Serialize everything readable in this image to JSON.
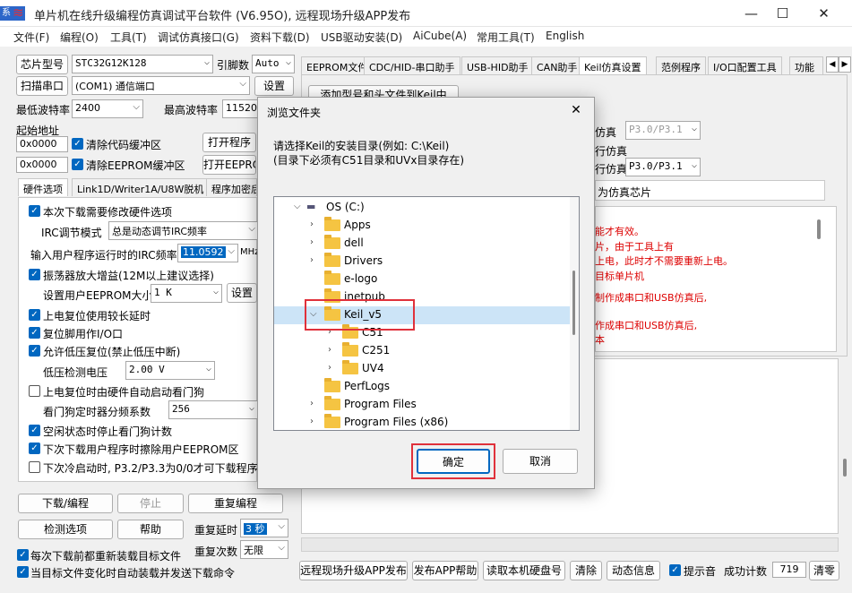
{
  "window": {
    "title": "单片机在线升级编程仿真调试平台软件 (V6.95O), 远程现场升级APP发布",
    "icon_text": "系",
    "minimize": "—",
    "maximize": "☐",
    "close": "✕"
  },
  "menu": [
    "文件(F)",
    "编程(O)",
    "工具(T)",
    "调试仿真接口(G)",
    "资料下载(D)",
    "USB驱动安装(D)",
    "AiCube(A)",
    "常用工具(T)",
    "English"
  ],
  "left": {
    "chip_type_btn": "芯片型号",
    "chip_type": "STC32G12K128",
    "pin_label": "引脚数",
    "pin_value": "Auto",
    "scan_port_btn": "扫描串口",
    "port_value": "(COM1) 通信端口",
    "settings_btn": "设置",
    "min_baud_label": "最低波特率",
    "min_baud": "2400",
    "max_baud_label": "最高波特率",
    "max_baud": "115200",
    "start_addr_label": "起始地址",
    "addr1": "0x0000",
    "clear_code_label": "清除代码缓冲区",
    "open_prog_btn": "打开程序",
    "addr2": "0x0000",
    "clear_eeprom_label": "清除EEPROM缓冲区",
    "open_eeprom_btn": "打开EEPRO",
    "tabs": [
      "硬件选项",
      "Link1D/Writer1A/U8W脱机",
      "程序加密后"
    ],
    "options": {
      "opt1": "本次下载需要修改硬件选项",
      "irc_mode_label": "IRC调节模式",
      "irc_mode": "总是动态调节IRC频率",
      "irc_freq_label": "输入用户程序运行时的IRC频率",
      "irc_freq": "11.0592",
      "irc_unit": "MHz",
      "opt_osc": "振荡器放大增益(12M以上建议选择)",
      "eeprom_label": "设置用户EEPROM大小",
      "eeprom_value": "1    K",
      "eeprom_btn": "设置",
      "opt_delay": "上电复位使用较长延时",
      "opt_reset": "复位脚用作I/O口",
      "opt_lowv": "允许低压复位(禁止低压中断)",
      "lowv_label": "低压检测电压",
      "lowv_value": "2.00 V",
      "opt_wdt": "上电复位时由硬件自动启动看门狗",
      "wdt_label": "看门狗定时器分频系数",
      "wdt_value": "256",
      "opt_idle": "空闲状态时停止看门狗计数",
      "opt_eeprom_erase": "下次下载用户程序时擦除用户EEPROM区",
      "opt_cold": "下次冷启动时, P3.2/P3.3为0/0才可下载程序"
    },
    "download_btn": "下载/编程",
    "stop_btn": "停止",
    "reprog_btn": "重复编程",
    "detect_btn": "检测选项",
    "help_btn": "帮助",
    "repeat_delay_label": "重复延时",
    "repeat_delay": "3 秒",
    "repeat_count_label": "重复次数",
    "repeat_count": "无限",
    "reload_label": "每次下载前都重新装载目标文件",
    "auto_label": "当目标文件变化时自动装载并发送下载命令"
  },
  "right": {
    "tabs": [
      "EEPROM文件",
      "CDC/HID-串口助手",
      "USB-HID助手",
      "CAN助手",
      "Keil仿真设置",
      "范例程序",
      "I/O口配置工具",
      "功能"
    ],
    "add_btn": "添加型号和头文件到Keil中",
    "sim_label1": "仿真",
    "sim_port1": "P3.0/P3.1",
    "sim_label2": "行仿真",
    "sim_label3": "行仿真",
    "sim_port3": "P3.0/P3.1",
    "sim_chip": "为仿真芯片",
    "notes": [
      "能才有效。",
      "片，由于工具上有",
      "上电，此时才不需要重新上电。",
      "目标单片机",
      "制作成串口和USB仿真后,",
      "作成串口和USB仿真后,",
      "本"
    ]
  },
  "bottom": {
    "publish_btn": "远程现场升级APP发布",
    "publish_help_btn": "发布APP帮助",
    "read_disk_btn": "读取本机硬盘号",
    "clear_btn": "清除",
    "dynamic_btn": "动态信息",
    "tone_label": "提示音",
    "success_label": "成功计数",
    "success_count": "719",
    "clear2_btn": "清零"
  },
  "dialog": {
    "title": "浏览文件夹",
    "prompt1": "请选择Keil的安装目录(例如: C:\\Keil)",
    "prompt2": "(目录下必须有C51目录和UVx目录存在)",
    "ok": "确定",
    "cancel": "取消",
    "tree": {
      "drive": "OS (C:)",
      "apps": "Apps",
      "dell": "dell",
      "drivers": "Drivers",
      "elogo": "e-logo",
      "inetpub": "inetpub",
      "keil": "Keil_v5",
      "c51": "C51",
      "c251": "C251",
      "uv4": "UV4",
      "perflogs": "PerfLogs",
      "progfiles": "Program Files",
      "progfiles86": "Program Files (x86)"
    }
  },
  "accent_color": "#0067c0",
  "highlight_color": "#e0313b"
}
